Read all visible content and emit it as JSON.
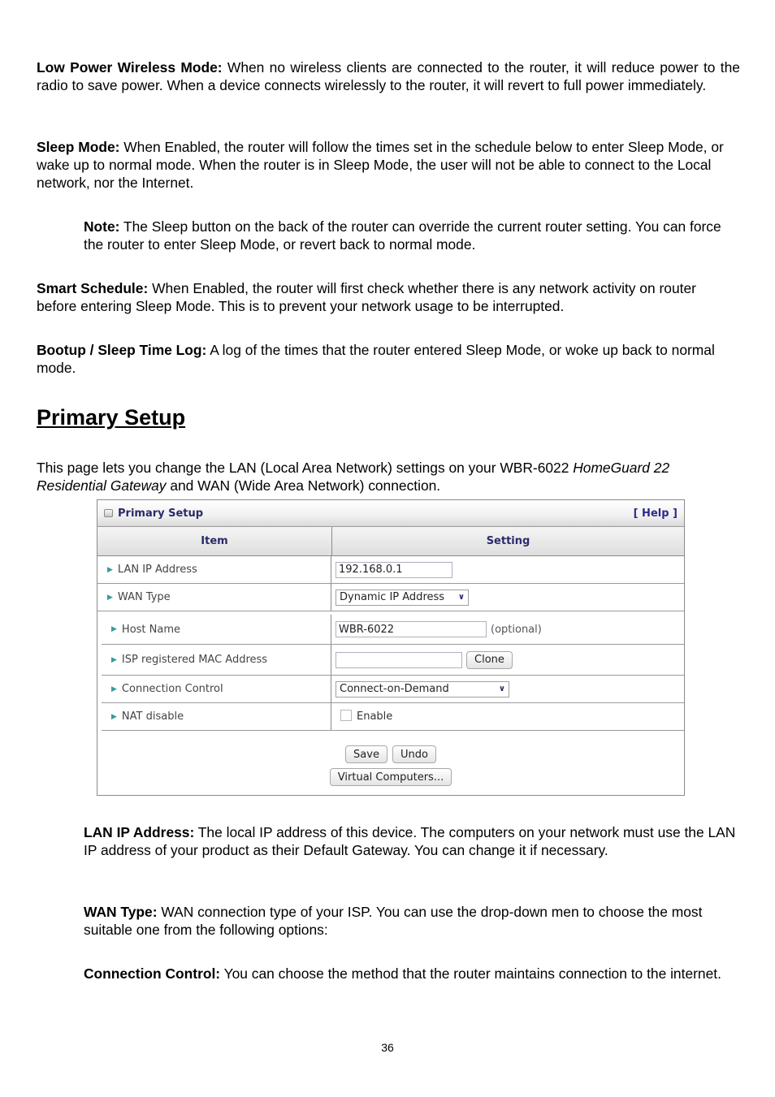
{
  "paragraphs": {
    "low_power": {
      "label": "Low Power Wireless Mode:",
      "text": " When no wireless clients are connected to the router, it will reduce power to the radio to save power. When a device connects wirelessly to the router, it will revert to full power immediately."
    },
    "sleep_mode": {
      "label": "Sleep Mode:",
      "text": " When Enabled, the router will follow the times set in the schedule below to enter Sleep Mode, or wake up to normal mode. When the router is in Sleep Mode, the user will not be able to connect to the Local network, nor the Internet."
    },
    "note": {
      "label": "Note:",
      "text": " The Sleep button on the back of the router can override the current router setting. You can force the router to enter Sleep Mode, or revert back to normal mode."
    },
    "smart_schedule": {
      "label": "Smart Schedule:",
      "text": " When Enabled, the router will first check whether there is any network activity on router before entering Sleep Mode. This is to prevent your network usage to be interrupted."
    },
    "bootup_log": {
      "label": "Bootup / Sleep Time Log:",
      "text": " A log of the times that the router entered Sleep Mode, or woke up back to normal mode."
    }
  },
  "section": {
    "heading": "Primary Setup",
    "intro_part1": "This page lets you change the LAN (Local Area Network) settings on your WBR-6022 ",
    "intro_italic": "HomeGuard 22 Residential Gateway",
    "intro_part2": " and WAN (Wide Area Network) connection."
  },
  "ui": {
    "title": "Primary Setup",
    "help_label": "[ Help ]",
    "col_item": "Item",
    "col_setting": "Setting",
    "rows": {
      "lan_ip": {
        "label": "LAN IP Address",
        "value": "192.168.0.1"
      },
      "wan_type": {
        "label": "WAN Type",
        "value": "Dynamic IP Address"
      },
      "host_name": {
        "label": "Host Name",
        "value": "WBR-6022",
        "note": "(optional)"
      },
      "mac": {
        "label": "ISP registered MAC Address",
        "value": "",
        "button": "Clone"
      },
      "conn_control": {
        "label": "Connection Control",
        "value": "Connect-on-Demand"
      },
      "nat": {
        "label": "NAT disable",
        "checkbox_label": "Enable",
        "checked": false
      }
    },
    "buttons": {
      "save": "Save",
      "undo": "Undo",
      "virtual": "Virtual Computers..."
    }
  },
  "descriptions": {
    "lan_ip": {
      "label": "LAN IP Address:",
      "text": " The local IP address of this device. The computers on your network must use the LAN IP address of your product as their Default Gateway. You can change it if necessary."
    },
    "wan_type": {
      "label": "WAN Type:",
      "text": " WAN connection type of your ISP. You can use the drop-down men to choose the most suitable one from the following options:"
    },
    "conn_control": {
      "label": "Connection Control:",
      "text": " You can choose the method that the router maintains connection to the internet."
    }
  },
  "page_number": "36"
}
